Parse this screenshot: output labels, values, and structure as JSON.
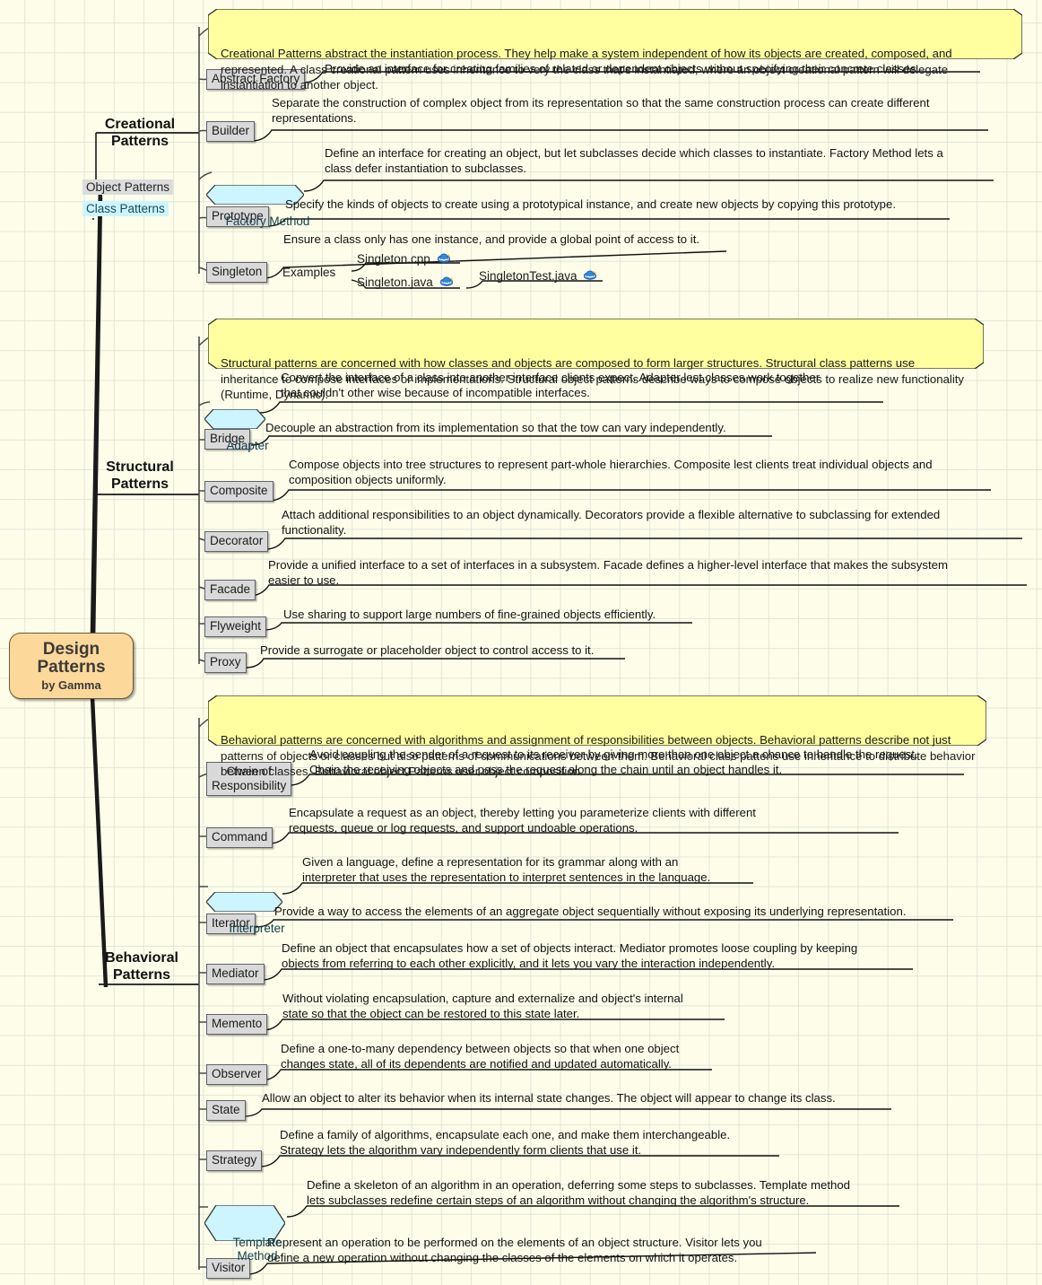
{
  "root": {
    "title_line1": "Design",
    "title_line2": "Patterns",
    "author": "by Gamma"
  },
  "legend": {
    "object_patterns": "Object Patterns",
    "class_patterns": "Class Patterns"
  },
  "colors": {
    "background": "#fdfdea",
    "grid": "#e2e6d8",
    "root_fill": "#fcd89a",
    "object_node_fill": "#d9d9d9",
    "class_node_fill": "#ccf5ff",
    "note_fill": "#ffffa0",
    "line": "#1a1a1a"
  },
  "branches": [
    {
      "id": "creational",
      "title": "Creational\nPatterns",
      "note": "Creational Patterns abstract the instantiation process.  They help make a system independent of how its objects are created, composed, and represented.  A class creational pattern uses inheritance to very  the class that's instantiated, where an object creational pattern will delegate instantiation to another object.",
      "patterns": [
        {
          "name": "Abstract Factory",
          "kind": "object",
          "description": "Provide an interface for creating families of related or dependent objects without specifying their concrete classes."
        },
        {
          "name": "Builder",
          "kind": "object",
          "description": "Separate the construction of complex object  from its representation so that the same construction process can create different\nrepresentations."
        },
        {
          "name": "Factory Method",
          "kind": "class",
          "description": "Define an interface for creating an object, but let subclasses decide which classes to instantiate.  Factory Method lets a\nclass defer instantiation to subclasses."
        },
        {
          "name": "Prototype",
          "kind": "object",
          "description": "Specify the kinds of objects to create using a prototypical instance, and create new objects by copying this prototype."
        },
        {
          "name": "Singleton",
          "kind": "object",
          "description": "Ensure a class only has one instance, and provide a global point of access to it.",
          "examples_label": "Examples",
          "examples": [
            {
              "label": "Singleton.cpp",
              "icon": "browser-link-icon"
            },
            {
              "label": "Singleton.java",
              "icon": "browser-link-icon",
              "children": [
                {
                  "label": "SingletonTest.java",
                  "icon": "browser-link-icon"
                }
              ]
            }
          ]
        }
      ]
    },
    {
      "id": "structural",
      "title": "Structural\nPatterns",
      "note": "Structural patterns are concerned with how classes and objects are composed to form larger structures.  Structural class patterns use inheritance to compose interfaces or implementations.  Structural object patterns describe ways to compose objects to realize new functionality (Runtime, Dynamic).",
      "patterns": [
        {
          "name": "Adapter",
          "kind": "class",
          "description": "Convert the interface of a class into another  interface clients expect.  Adapter lest classes work together\nthat couldn't other wise because of incompatible interfaces."
        },
        {
          "name": "Bridge",
          "kind": "object",
          "description": "Decouple an abstraction from its implementation so that the tow can vary independently."
        },
        {
          "name": "Composite",
          "kind": "object",
          "description": "Compose objects into tree structures to represent part-whole hierarchies.  Composite lest clients treat individual objects and\ncomposition objects uniformly."
        },
        {
          "name": "Decorator",
          "kind": "object",
          "description": "Attach additional responsibilities to an object dynamically.  Decorators provide a flexible alternative to subclassing for extended\nfunctionality."
        },
        {
          "name": "Facade",
          "kind": "object",
          "description": "Provide a unified interface to a set of interfaces in a subsystem.  Facade defines a higher-level interface that makes the subsystem\neasier to use."
        },
        {
          "name": "Flyweight",
          "kind": "object",
          "description": "Use sharing to support large numbers of fine-grained objects efficiently."
        },
        {
          "name": "Proxy",
          "kind": "object",
          "description": "Provide a surrogate or placeholder object to control access to it."
        }
      ]
    },
    {
      "id": "behavioral",
      "title": "Behavioral\nPatterns",
      "note": "Behavioral patterns are concerned with algorithms and assignment of responsibilities between objects.  Behavioral patterns describe not just patterns of objects or classes but also patterns of communications between them.  Behavioral class pattens use inheritance to distribute behavior between classes.  Behavioral object Patterns user object composition.",
      "patterns": [
        {
          "name": "Chain of\nResponsibility",
          "kind": "object",
          "description": "Avoid coupling the sender of a request to its receiver by giving more than one object a chance to handle the request.\nChain the receiving objects and pass the request along the chain until an object handles it."
        },
        {
          "name": "Command",
          "kind": "object",
          "description": "Encapsulate a request as an object, thereby letting you parameterize clients with different\nrequests, queue or log requests, and support undoable operations."
        },
        {
          "name": "Interpreter",
          "kind": "class",
          "description": "Given a language, define a representation for its grammar along with an\ninterpreter that uses the representation to interpret sentences in the language."
        },
        {
          "name": "Iterator",
          "kind": "object",
          "description": "Provide a way to access the elements of an aggregate object sequentially without exposing its underlying representation."
        },
        {
          "name": "Mediator",
          "kind": "object",
          "description": "Define an object that encapsulates how a set of objects interact.  Mediator promotes loose coupling by keeping\nobjects from referring to each other explicitly, and it lets you vary the interaction independently."
        },
        {
          "name": "Memento",
          "kind": "object",
          "description": "Without violating encapsulation, capture and externalize and object's internal\nstate so that the object can be restored to this state later."
        },
        {
          "name": "Observer",
          "kind": "object",
          "description": "Define a one-to-many dependency between objects so that when one object\nchanges state, all of its dependents are notified and updated automatically."
        },
        {
          "name": "State",
          "kind": "object",
          "description": "Allow an object to alter its behavior when its internal state changes.  The object will appear to change its class."
        },
        {
          "name": "Strategy",
          "kind": "object",
          "description": "Define a family of algorithms, encapsulate each one, and make them interchangeable.\nStrategy lets the algorithm vary independently form clients that use it."
        },
        {
          "name": "Template\nMethod",
          "kind": "class",
          "description": "Define a skeleton of an algorithm in an operation, deferring some steps to subclasses.  Template method\nlets subclasses redefine certain steps of an algorithm without changing the algorithm's structure."
        },
        {
          "name": "Visitor",
          "kind": "object",
          "description": "Represent an operation to be performed on the elements of an object structure.  Visitor lets you\ndefine a new operation without changing the classes of the elements on which  it operates."
        }
      ]
    }
  ]
}
